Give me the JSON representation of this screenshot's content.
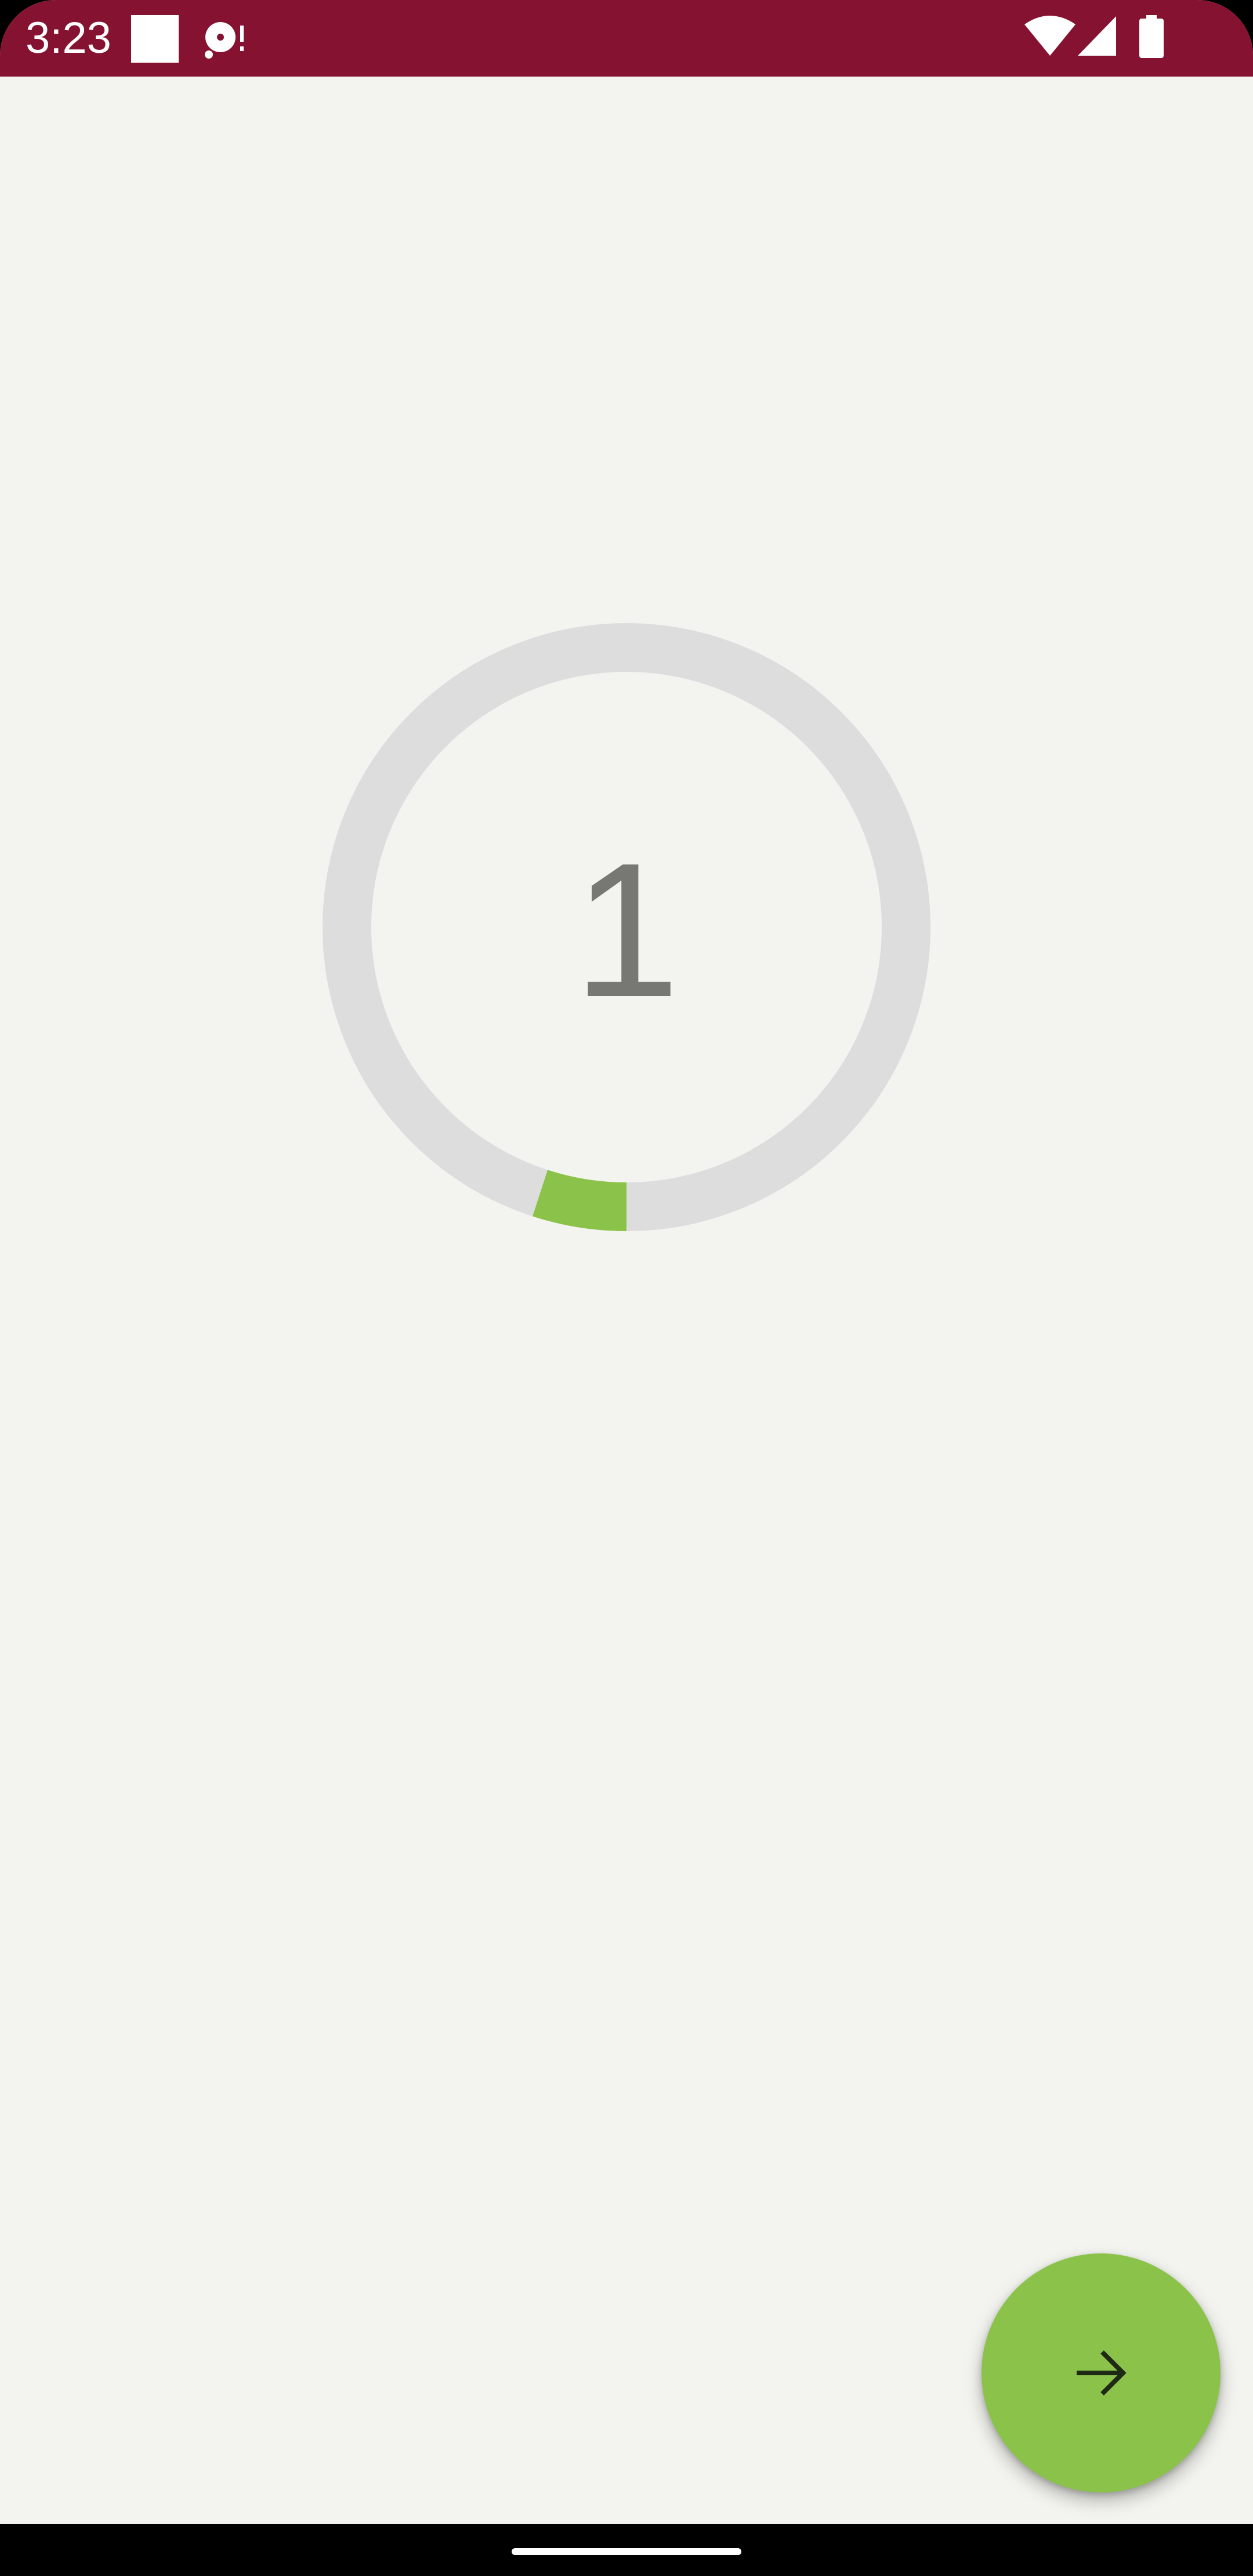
{
  "status_bar": {
    "time": "3:23",
    "background": "#861231",
    "icons": [
      "notification-square-icon",
      "media-disc-icon",
      "wifi-icon",
      "cell-signal-icon",
      "battery-icon"
    ]
  },
  "timer": {
    "count": "1",
    "progress_fraction": 0.05,
    "track_color": "#dddddd",
    "progress_color": "#8bc34a",
    "text_color": "#777873"
  },
  "fab": {
    "icon": "arrow-right-icon",
    "color": "#8bc34a"
  },
  "colors": {
    "background": "#f3f4ef",
    "nav_bar": "#000000"
  }
}
